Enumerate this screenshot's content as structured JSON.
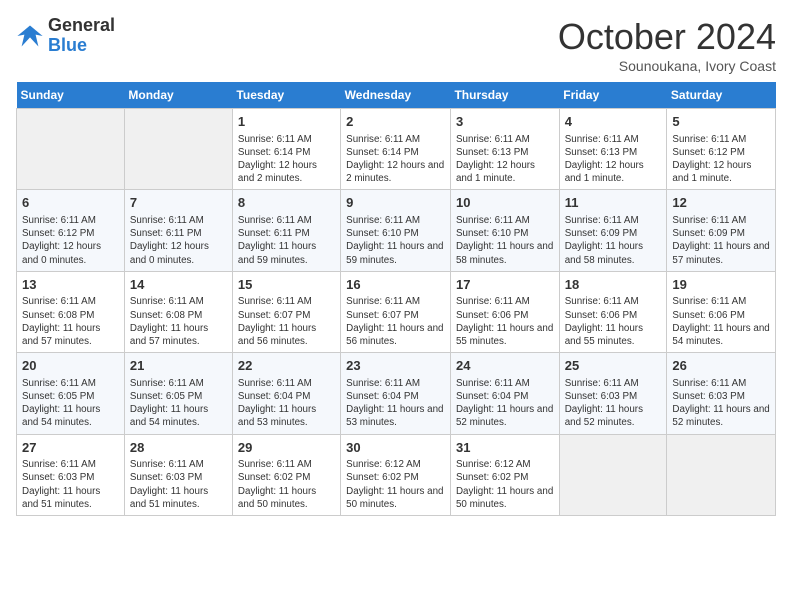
{
  "header": {
    "logo_line1": "General",
    "logo_line2": "Blue",
    "month": "October 2024",
    "location": "Sounoukana, Ivory Coast"
  },
  "weekdays": [
    "Sunday",
    "Monday",
    "Tuesday",
    "Wednesday",
    "Thursday",
    "Friday",
    "Saturday"
  ],
  "weeks": [
    [
      {
        "day": "",
        "info": ""
      },
      {
        "day": "",
        "info": ""
      },
      {
        "day": "1",
        "info": "Sunrise: 6:11 AM\nSunset: 6:14 PM\nDaylight: 12 hours and 2 minutes."
      },
      {
        "day": "2",
        "info": "Sunrise: 6:11 AM\nSunset: 6:14 PM\nDaylight: 12 hours and 2 minutes."
      },
      {
        "day": "3",
        "info": "Sunrise: 6:11 AM\nSunset: 6:13 PM\nDaylight: 12 hours and 1 minute."
      },
      {
        "day": "4",
        "info": "Sunrise: 6:11 AM\nSunset: 6:13 PM\nDaylight: 12 hours and 1 minute."
      },
      {
        "day": "5",
        "info": "Sunrise: 6:11 AM\nSunset: 6:12 PM\nDaylight: 12 hours and 1 minute."
      }
    ],
    [
      {
        "day": "6",
        "info": "Sunrise: 6:11 AM\nSunset: 6:12 PM\nDaylight: 12 hours and 0 minutes."
      },
      {
        "day": "7",
        "info": "Sunrise: 6:11 AM\nSunset: 6:11 PM\nDaylight: 12 hours and 0 minutes."
      },
      {
        "day": "8",
        "info": "Sunrise: 6:11 AM\nSunset: 6:11 PM\nDaylight: 11 hours and 59 minutes."
      },
      {
        "day": "9",
        "info": "Sunrise: 6:11 AM\nSunset: 6:10 PM\nDaylight: 11 hours and 59 minutes."
      },
      {
        "day": "10",
        "info": "Sunrise: 6:11 AM\nSunset: 6:10 PM\nDaylight: 11 hours and 58 minutes."
      },
      {
        "day": "11",
        "info": "Sunrise: 6:11 AM\nSunset: 6:09 PM\nDaylight: 11 hours and 58 minutes."
      },
      {
        "day": "12",
        "info": "Sunrise: 6:11 AM\nSunset: 6:09 PM\nDaylight: 11 hours and 57 minutes."
      }
    ],
    [
      {
        "day": "13",
        "info": "Sunrise: 6:11 AM\nSunset: 6:08 PM\nDaylight: 11 hours and 57 minutes."
      },
      {
        "day": "14",
        "info": "Sunrise: 6:11 AM\nSunset: 6:08 PM\nDaylight: 11 hours and 57 minutes."
      },
      {
        "day": "15",
        "info": "Sunrise: 6:11 AM\nSunset: 6:07 PM\nDaylight: 11 hours and 56 minutes."
      },
      {
        "day": "16",
        "info": "Sunrise: 6:11 AM\nSunset: 6:07 PM\nDaylight: 11 hours and 56 minutes."
      },
      {
        "day": "17",
        "info": "Sunrise: 6:11 AM\nSunset: 6:06 PM\nDaylight: 11 hours and 55 minutes."
      },
      {
        "day": "18",
        "info": "Sunrise: 6:11 AM\nSunset: 6:06 PM\nDaylight: 11 hours and 55 minutes."
      },
      {
        "day": "19",
        "info": "Sunrise: 6:11 AM\nSunset: 6:06 PM\nDaylight: 11 hours and 54 minutes."
      }
    ],
    [
      {
        "day": "20",
        "info": "Sunrise: 6:11 AM\nSunset: 6:05 PM\nDaylight: 11 hours and 54 minutes."
      },
      {
        "day": "21",
        "info": "Sunrise: 6:11 AM\nSunset: 6:05 PM\nDaylight: 11 hours and 54 minutes."
      },
      {
        "day": "22",
        "info": "Sunrise: 6:11 AM\nSunset: 6:04 PM\nDaylight: 11 hours and 53 minutes."
      },
      {
        "day": "23",
        "info": "Sunrise: 6:11 AM\nSunset: 6:04 PM\nDaylight: 11 hours and 53 minutes."
      },
      {
        "day": "24",
        "info": "Sunrise: 6:11 AM\nSunset: 6:04 PM\nDaylight: 11 hours and 52 minutes."
      },
      {
        "day": "25",
        "info": "Sunrise: 6:11 AM\nSunset: 6:03 PM\nDaylight: 11 hours and 52 minutes."
      },
      {
        "day": "26",
        "info": "Sunrise: 6:11 AM\nSunset: 6:03 PM\nDaylight: 11 hours and 52 minutes."
      }
    ],
    [
      {
        "day": "27",
        "info": "Sunrise: 6:11 AM\nSunset: 6:03 PM\nDaylight: 11 hours and 51 minutes."
      },
      {
        "day": "28",
        "info": "Sunrise: 6:11 AM\nSunset: 6:03 PM\nDaylight: 11 hours and 51 minutes."
      },
      {
        "day": "29",
        "info": "Sunrise: 6:11 AM\nSunset: 6:02 PM\nDaylight: 11 hours and 50 minutes."
      },
      {
        "day": "30",
        "info": "Sunrise: 6:12 AM\nSunset: 6:02 PM\nDaylight: 11 hours and 50 minutes."
      },
      {
        "day": "31",
        "info": "Sunrise: 6:12 AM\nSunset: 6:02 PM\nDaylight: 11 hours and 50 minutes."
      },
      {
        "day": "",
        "info": ""
      },
      {
        "day": "",
        "info": ""
      }
    ]
  ]
}
